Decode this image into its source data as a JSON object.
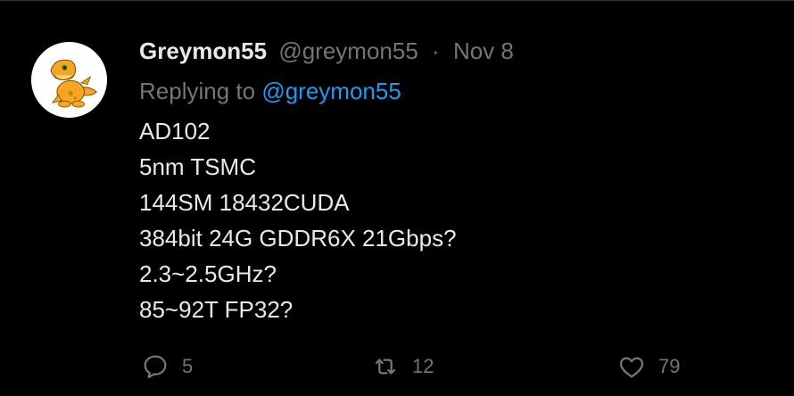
{
  "tweet": {
    "author": {
      "display_name": "Greymon55",
      "handle": "@greymon55"
    },
    "separator": "·",
    "date": "Nov 8",
    "replying": {
      "prefix": "Replying to",
      "target": "@greymon55"
    },
    "lines": [
      "AD102",
      "5nm TSMC",
      "144SM 18432CUDA",
      "384bit 24G GDDR6X 21Gbps?",
      "2.3~2.5GHz?",
      "85~92T FP32?"
    ]
  },
  "actions": {
    "reply": {
      "icon": "reply-icon",
      "count": "5"
    },
    "retweet": {
      "icon": "retweet-icon",
      "count": "12"
    },
    "like": {
      "icon": "heart-icon",
      "count": "79"
    }
  },
  "colors": {
    "background": "#000000",
    "text": "#e7e9ea",
    "muted": "#71767b",
    "link": "#1d9bf0",
    "avatar_orange": "#f5a623"
  }
}
